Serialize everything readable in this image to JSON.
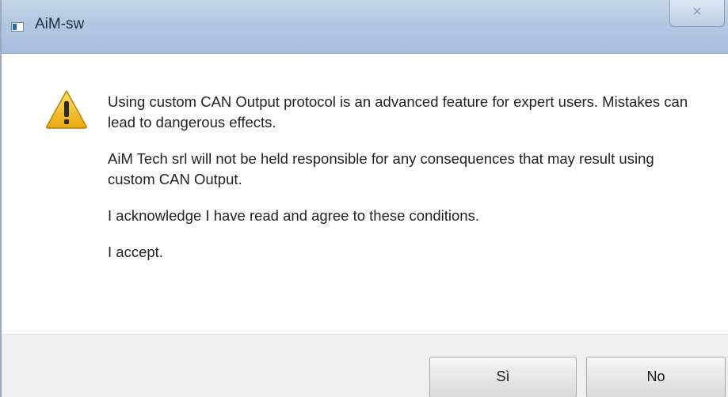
{
  "window": {
    "title": "AiM-sw",
    "close_glyph": "✕",
    "app_icon": "app-window-icon"
  },
  "dialog": {
    "icon": "warning-icon",
    "messages": [
      "Using custom CAN Output protocol is an advanced feature for expert users. Mistakes can lead to dangerous effects.",
      "AiM Tech srl will not be held responsible for any consequences that may result using custom CAN Output.",
      "I acknowledge I have read and agree to these conditions.",
      "I accept."
    ]
  },
  "buttons": {
    "yes_label": "Sì",
    "no_label": "No"
  },
  "colors": {
    "titlebar": "#b2c7e2",
    "warning_fill": "#f5c51e",
    "footer": "#efefef"
  }
}
